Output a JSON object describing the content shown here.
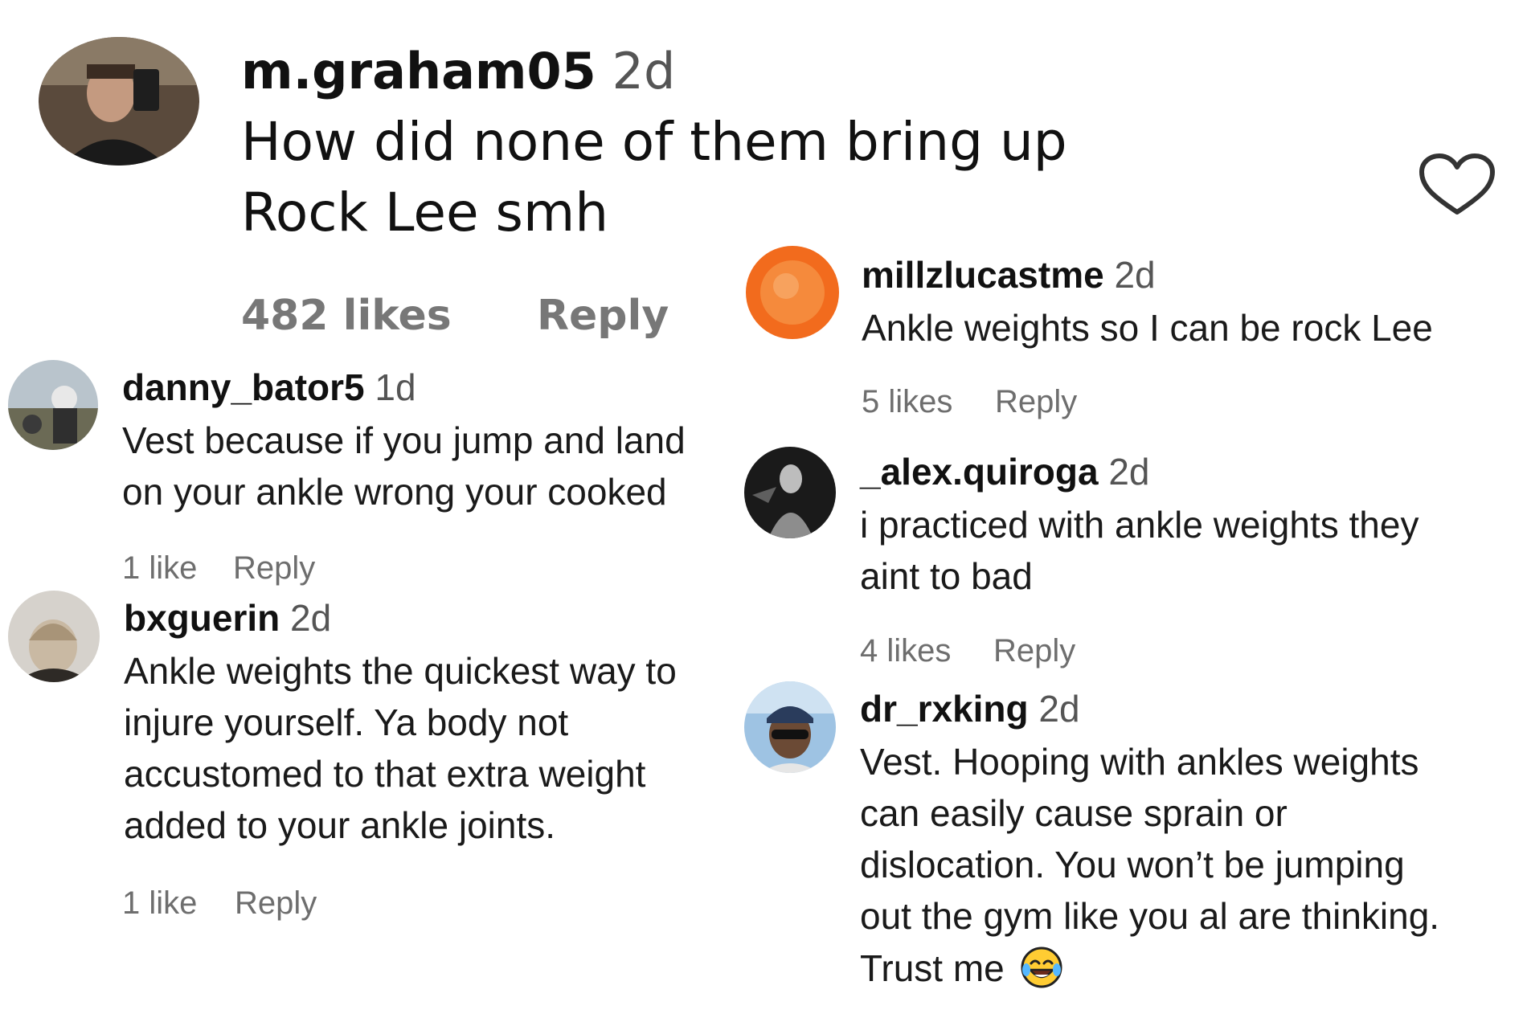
{
  "main_comment": {
    "username": "m.graham05",
    "time": "2d",
    "text_lines": [
      "How did none of them bring up",
      "Rock Lee smh"
    ],
    "likes": "482 likes",
    "reply": "Reply"
  },
  "replies": [
    {
      "username": "danny_bator5",
      "time": "1d",
      "text_lines": [
        "Vest because if you jump and land",
        "on your ankle wrong your cooked"
      ],
      "likes": "1 like",
      "reply": "Reply"
    },
    {
      "username": "bxguerin",
      "time": "2d",
      "text_lines": [
        "Ankle weights the quickest way to",
        "injure yourself. Ya body not",
        "accustomed to that extra weight",
        "added to your ankle joints."
      ],
      "likes": "1 like",
      "reply": "Reply"
    },
    {
      "username": "millzlucastme",
      "time": "2d",
      "text_lines": [
        "Ankle weights so I can be rock Lee"
      ],
      "likes": "5 likes",
      "reply": "Reply"
    },
    {
      "username": "_alex.quiroga",
      "time": "2d",
      "text_lines": [
        "i practiced with ankle weights they",
        "aint to bad"
      ],
      "likes": "4 likes",
      "reply": "Reply"
    },
    {
      "username": "dr_rxking",
      "time": "2d",
      "text_lines": [
        "Vest. Hooping with ankles weights",
        "can easily cause sprain or",
        "dislocation. You won’t be jumping",
        "out the gym like you al are thinking.",
        "Trust me"
      ],
      "likes": "",
      "reply": ""
    }
  ],
  "icons": {
    "like": "heart-outline-icon",
    "emoji": "face-with-tears-of-joy-emoji"
  },
  "colors": {
    "username": "#111111",
    "text": "#1a1a1a",
    "meta": "#6e6e6e",
    "background": "#ffffff"
  }
}
